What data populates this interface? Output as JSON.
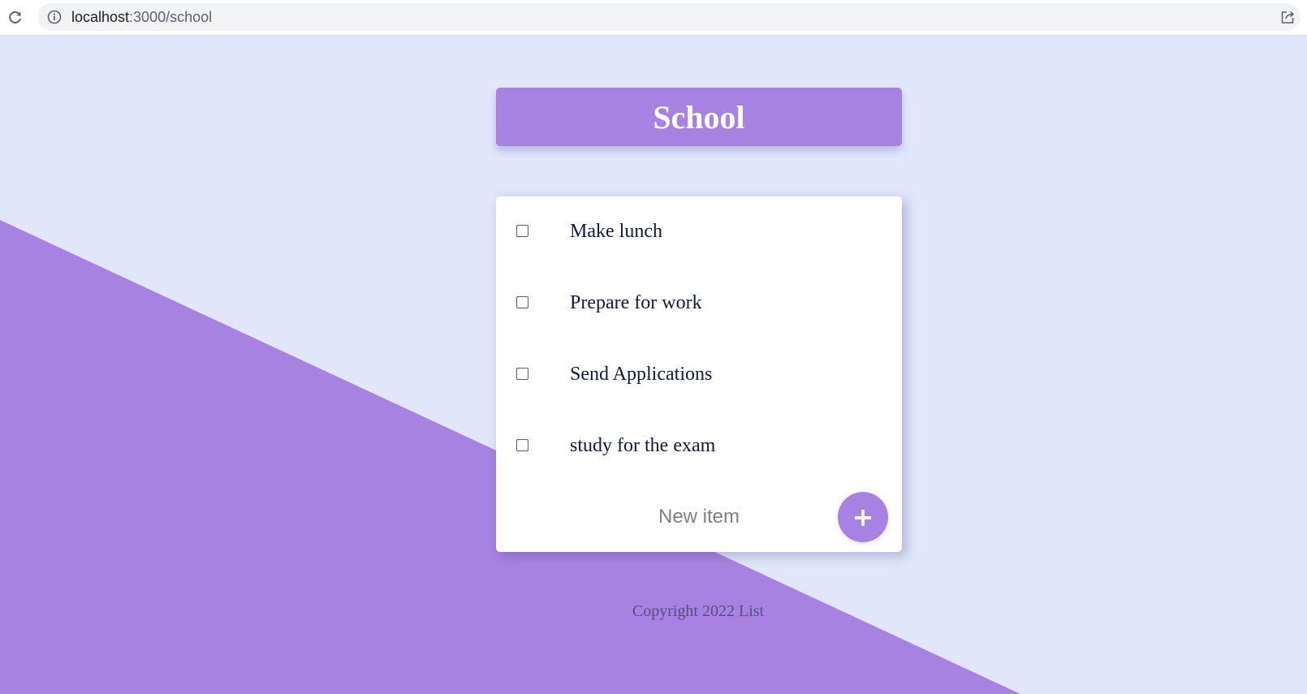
{
  "browser": {
    "url_host": "localhost",
    "url_path": ":3000/school"
  },
  "heading": {
    "title": "School"
  },
  "todo": {
    "items": [
      {
        "label": "Make lunch",
        "checked": false
      },
      {
        "label": "Prepare for work",
        "checked": false
      },
      {
        "label": "Send Applications",
        "checked": false
      },
      {
        "label": "study for the exam",
        "checked": false
      }
    ],
    "new_item_placeholder": "New item",
    "add_button_label": "+"
  },
  "footer": {
    "text": "Copyright 2022 List"
  },
  "colors": {
    "accent": "#a683e3",
    "background": "#e1e6fb",
    "card": "#ffffff",
    "item_text": "#0f1a44"
  },
  "icons": {
    "reload": "reload-icon",
    "info": "info-icon",
    "share": "share-icon",
    "add": "plus-icon"
  }
}
